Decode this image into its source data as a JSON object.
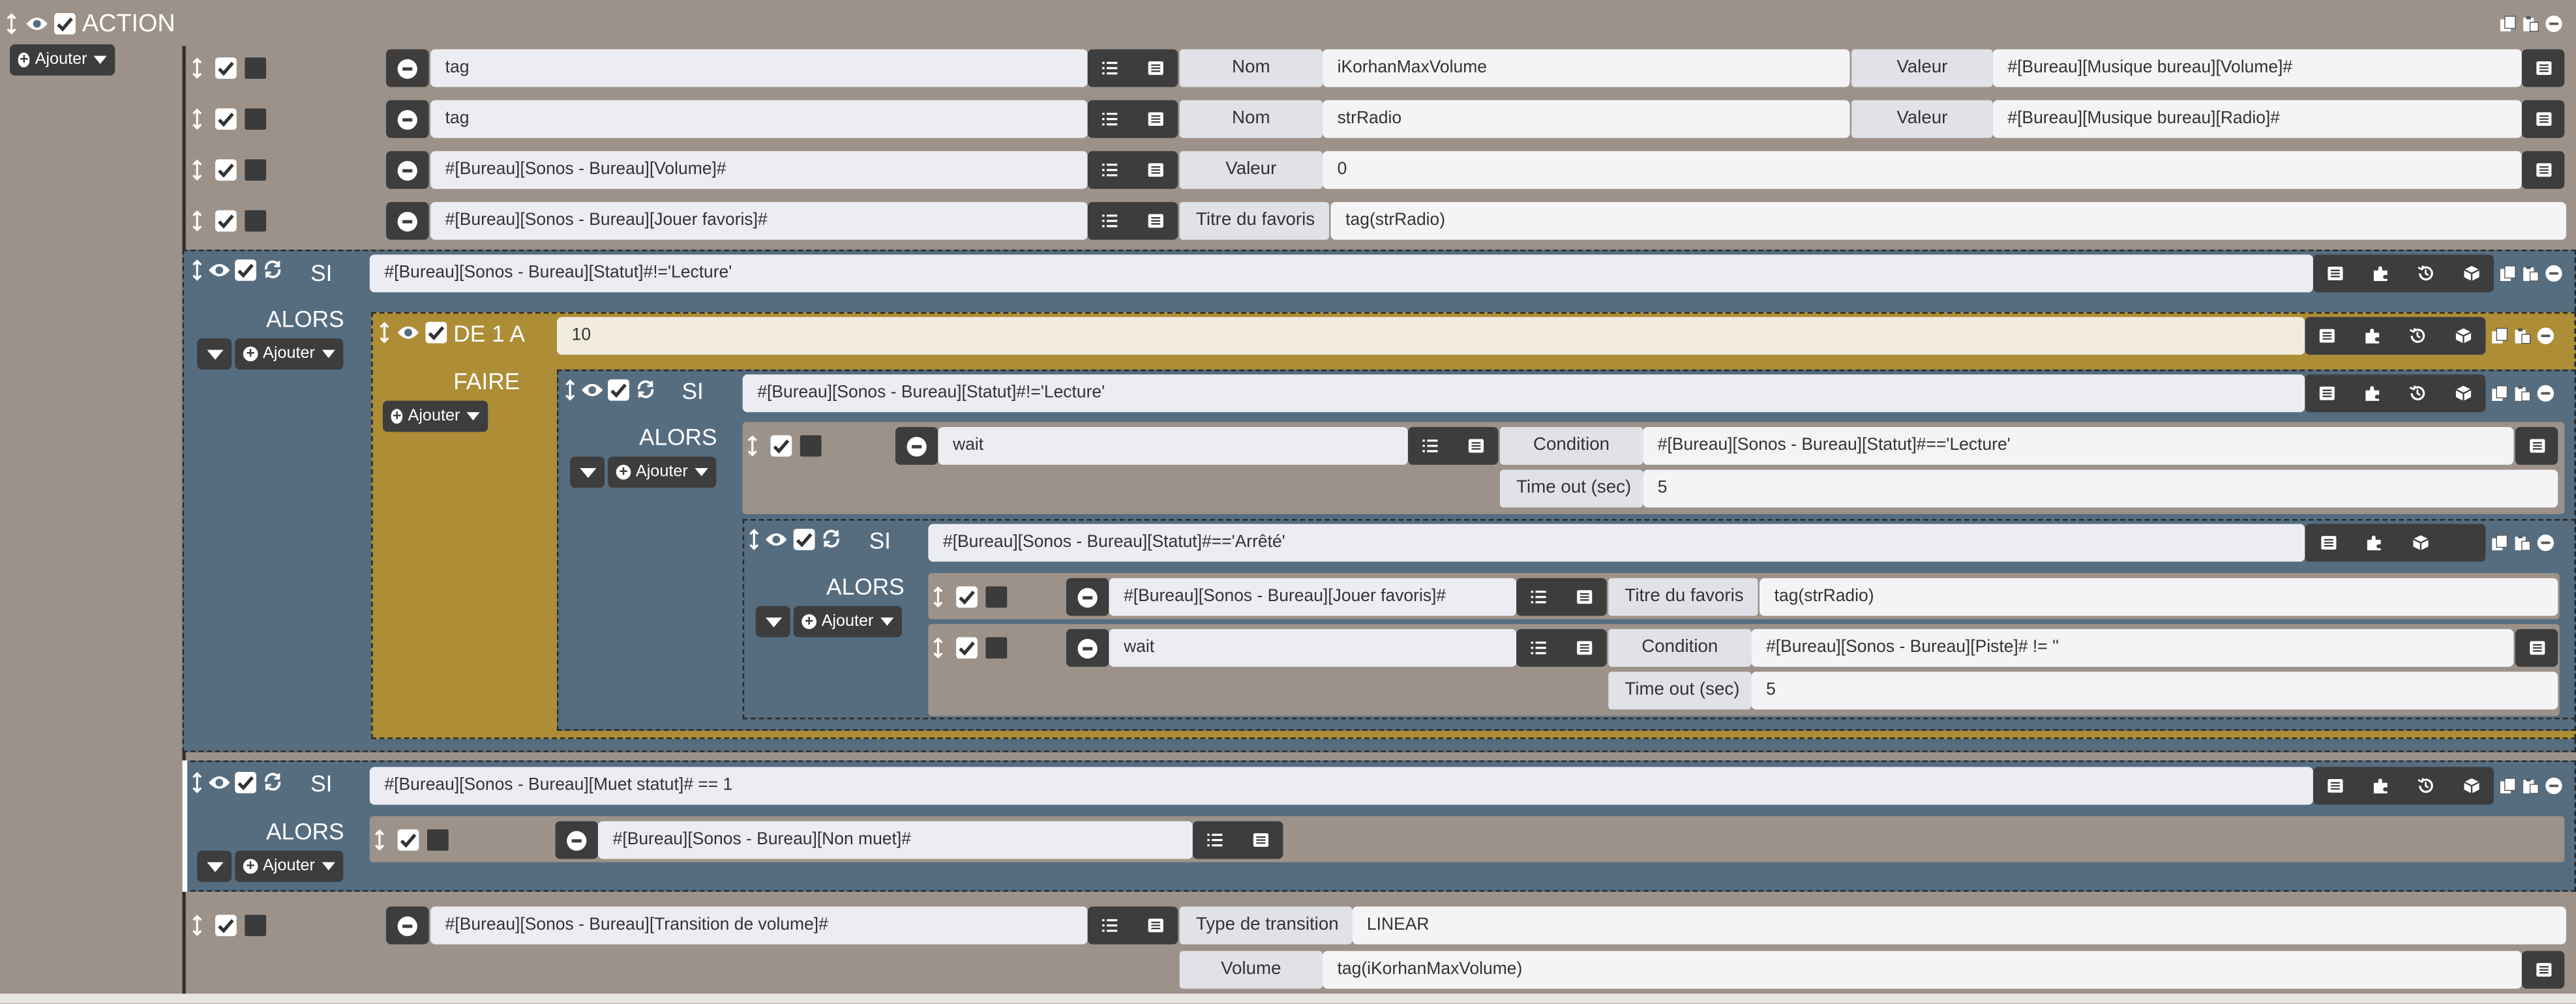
{
  "header": {
    "title": "ACTION",
    "add_label": "Ajouter"
  },
  "rows": [
    {
      "fn": "tag",
      "l1": "Nom",
      "v1": "iKorhanMaxVolume",
      "l2": "Valeur",
      "v2": "#[Bureau][Musique bureau][Volume]#"
    },
    {
      "fn": "tag",
      "l1": "Nom",
      "v1": "strRadio",
      "l2": "Valeur",
      "v2": "#[Bureau][Musique bureau][Radio]#"
    },
    {
      "fn": "#[Bureau][Sonos - Bureau][Volume]#",
      "l1": "Valeur",
      "v1": "0"
    },
    {
      "fn": "#[Bureau][Sonos - Bureau][Jouer favoris]#",
      "l1": "Titre du favoris",
      "v1": "tag(strRadio)"
    }
  ],
  "si1": {
    "kw": "SI",
    "cond": "#[Bureau][Sonos - Bureau][Statut]#!='Lecture'",
    "alors": "ALORS",
    "add": "Ajouter"
  },
  "loop": {
    "kw": "DE 1 A",
    "value": "10",
    "faire": "FAIRE",
    "add": "Ajouter"
  },
  "si2": {
    "kw": "SI",
    "cond": "#[Bureau][Sonos - Bureau][Statut]#!='Lecture'",
    "alors": "ALORS",
    "add": "Ajouter",
    "wait": {
      "fn": "wait",
      "l1": "Condition",
      "v1": "#[Bureau][Sonos - Bureau][Statut]#=='Lecture'",
      "l2": "Time out (sec)",
      "v2": "5"
    }
  },
  "si3": {
    "kw": "SI",
    "cond": "#[Bureau][Sonos - Bureau][Statut]#=='Arrêté'",
    "alors": "ALORS",
    "add": "Ajouter",
    "play": {
      "fn": "#[Bureau][Sonos - Bureau][Jouer favoris]#",
      "l1": "Titre du favoris",
      "v1": "tag(strRadio)"
    },
    "wait": {
      "fn": "wait",
      "l1": "Condition",
      "v1": "#[Bureau][Sonos - Bureau][Piste]# != ''",
      "l2": "Time out (sec)",
      "v2": "5"
    }
  },
  "si4": {
    "kw": "SI",
    "cond": "#[Bureau][Sonos - Bureau][Muet statut]# == 1",
    "alors": "ALORS",
    "add": "Ajouter",
    "mute": {
      "fn": "#[Bureau][Sonos - Bureau][Non muet]#"
    }
  },
  "transition": {
    "fn": "#[Bureau][Sonos - Bureau][Transition de volume]#",
    "l1": "Type de transition",
    "v1": "LINEAR",
    "l2": "Volume",
    "v2": "tag(iKorhanMaxVolume)"
  }
}
